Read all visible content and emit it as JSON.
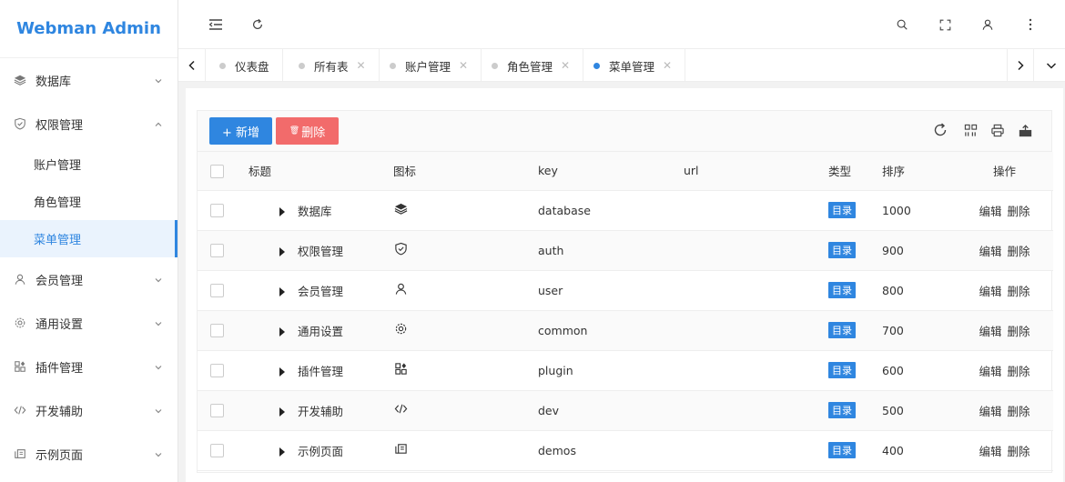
{
  "app": {
    "title": "Webman Admin"
  },
  "sidebar": {
    "items": [
      {
        "label": "数据库",
        "icon": "layers-icon"
      },
      {
        "label": "权限管理",
        "icon": "shield-icon",
        "expanded": true,
        "children": [
          {
            "label": "账户管理"
          },
          {
            "label": "角色管理"
          },
          {
            "label": "菜单管理",
            "active": true
          }
        ]
      },
      {
        "label": "会员管理",
        "icon": "user-icon"
      },
      {
        "label": "通用设置",
        "icon": "gear-icon"
      },
      {
        "label": "插件管理",
        "icon": "apps-icon"
      },
      {
        "label": "开发辅助",
        "icon": "code-icon"
      },
      {
        "label": "示例页面",
        "icon": "pages-icon"
      }
    ]
  },
  "tabs": [
    {
      "label": "仪表盘",
      "closable": false
    },
    {
      "label": "所有表",
      "closable": true
    },
    {
      "label": "账户管理",
      "closable": true
    },
    {
      "label": "角色管理",
      "closable": true
    },
    {
      "label": "菜单管理",
      "closable": true,
      "active": true
    }
  ],
  "toolbar": {
    "add_label": "+ 新增",
    "delete_label": "删除"
  },
  "table": {
    "columns": [
      "标题",
      "图标",
      "key",
      "url",
      "类型",
      "排序",
      "操作"
    ],
    "rows": [
      {
        "title": "数据库",
        "icon": "layers-icon",
        "key": "database",
        "url": "",
        "type": "目录",
        "sort": "1000"
      },
      {
        "title": "权限管理",
        "icon": "shield-icon",
        "key": "auth",
        "url": "",
        "type": "目录",
        "sort": "900"
      },
      {
        "title": "会员管理",
        "icon": "user-icon",
        "key": "user",
        "url": "",
        "type": "目录",
        "sort": "800"
      },
      {
        "title": "通用设置",
        "icon": "gear-icon",
        "key": "common",
        "url": "",
        "type": "目录",
        "sort": "700"
      },
      {
        "title": "插件管理",
        "icon": "apps-icon",
        "key": "plugin",
        "url": "",
        "type": "目录",
        "sort": "600"
      },
      {
        "title": "开发辅助",
        "icon": "code-icon",
        "key": "dev",
        "url": "",
        "type": "目录",
        "sort": "500"
      },
      {
        "title": "示例页面",
        "icon": "pages-icon",
        "key": "demos",
        "url": "",
        "type": "目录",
        "sort": "400"
      }
    ],
    "actions": {
      "edit": "编辑",
      "delete": "删除"
    }
  },
  "colors": {
    "accent": "#2f86e0",
    "danger": "#f26b6b"
  }
}
